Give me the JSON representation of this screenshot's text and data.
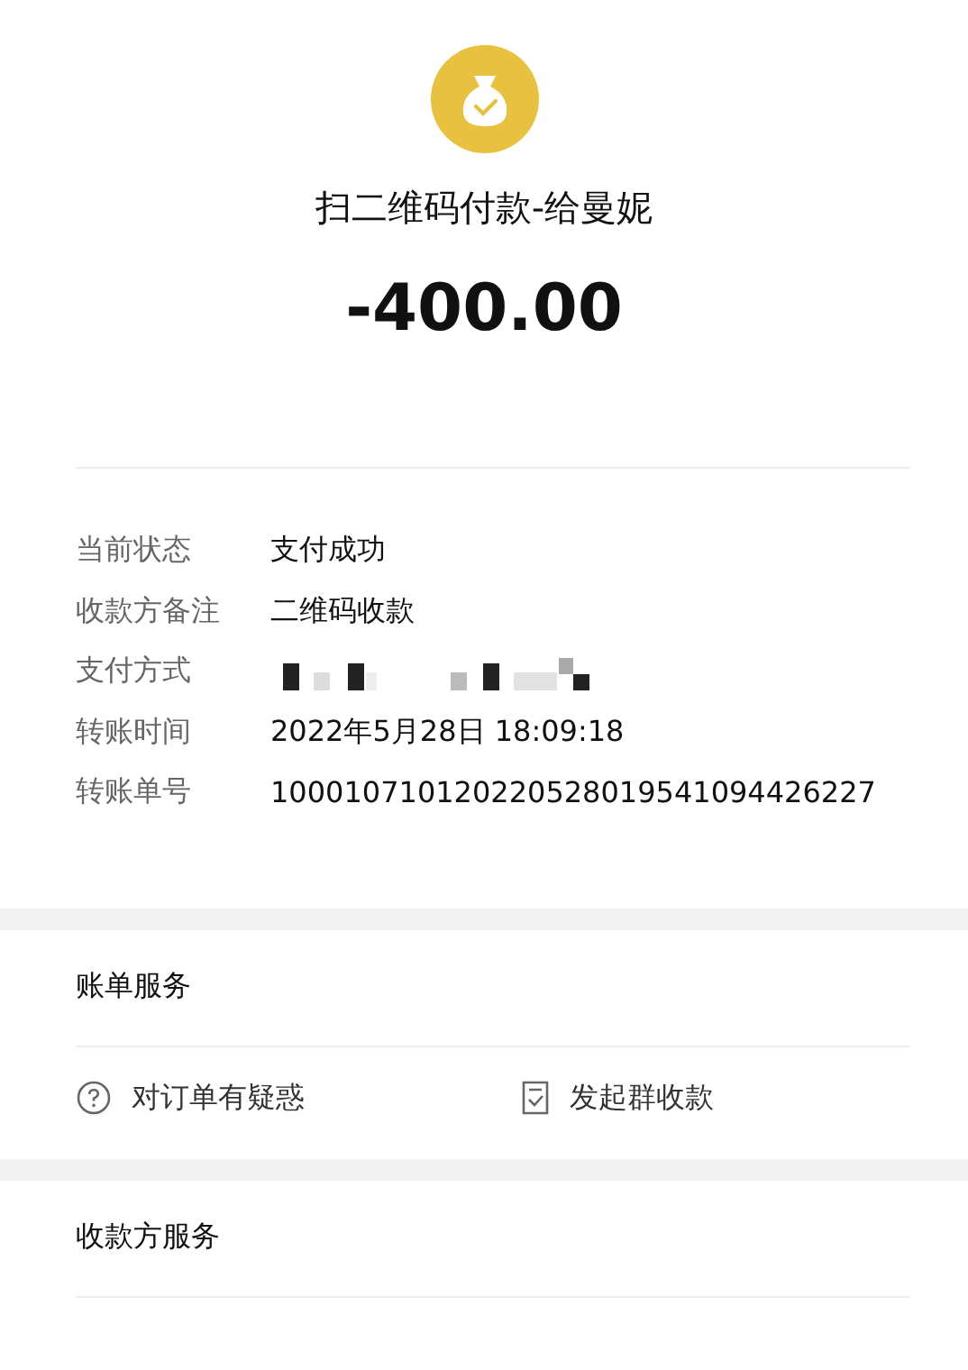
{
  "header": {
    "title": "扫二维码付款-给曼妮",
    "amount": "-400.00"
  },
  "details": [
    {
      "label": "当前状态",
      "kind": "text",
      "value": "支付成功"
    },
    {
      "label": "收款方备注",
      "kind": "text",
      "value": "二维码收款"
    },
    {
      "label": "支付方式",
      "kind": "redacted"
    },
    {
      "label": "转账时间",
      "kind": "text",
      "value": "2022年5月28日 18:09:18"
    },
    {
      "label": "转账单号",
      "kind": "text",
      "value": "100010710120220528019541094426227"
    }
  ],
  "bill_service": {
    "title": "账单服务",
    "actions": [
      {
        "label": "对订单有疑惑",
        "kind": "question"
      },
      {
        "label": "发起群收款",
        "kind": "document"
      }
    ]
  },
  "payee_service": {
    "title": "收款方服务"
  }
}
